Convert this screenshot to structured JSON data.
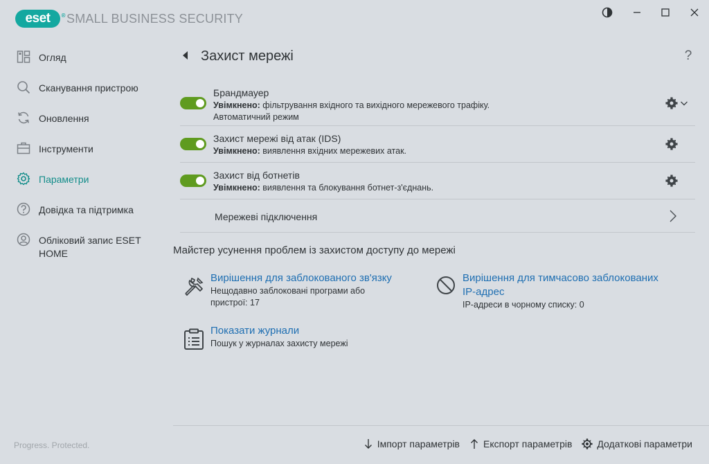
{
  "app": {
    "logo_text": "eset",
    "logo_mark": "®",
    "product_name": "SMALL BUSINESS SECURITY"
  },
  "window_controls": [
    {
      "name": "theme-toggle-icon"
    },
    {
      "name": "minimize-icon"
    },
    {
      "name": "maximize-icon"
    },
    {
      "name": "close-icon"
    }
  ],
  "sidebar": {
    "items": [
      {
        "label": "Огляд",
        "icon": "overview-icon"
      },
      {
        "label": "Сканування пристрою",
        "icon": "search-icon"
      },
      {
        "label": "Оновлення",
        "icon": "refresh-icon"
      },
      {
        "label": "Інструменти",
        "icon": "briefcase-icon"
      },
      {
        "label": "Параметри",
        "icon": "gear-icon",
        "active": true
      },
      {
        "label": "Довідка та підтримка",
        "icon": "help-icon"
      },
      {
        "label": "Обліковий запис ESET HOME",
        "icon": "account-icon"
      }
    ],
    "footer": "Progress. Protected."
  },
  "page": {
    "title": "Захист мережі",
    "help": "?"
  },
  "settings": [
    {
      "title": "Брандмауер",
      "status": "Увімкнено:",
      "desc": " фільтрування вхідного та вихідного мережевого трафіку.",
      "sub": "Автоматичний режим",
      "enabled": true
    },
    {
      "title": "Захист мережі від атак (IDS)",
      "status": "Увімкнено:",
      "desc": " виявлення вхідних мережевих атак.",
      "enabled": true
    },
    {
      "title": "Захист від ботнетів",
      "status": "Увімкнено:",
      "desc": " виявлення та блокування ботнет-з'єднань.",
      "enabled": true
    },
    {
      "title": "Мережеві підключення"
    }
  ],
  "wizard": {
    "title": "Майстер усунення проблем із захистом доступу до мережі",
    "items": [
      {
        "link": "Вирішення для заблокованого зв'язку",
        "desc_line1": "Нещодавно заблоковані програми або",
        "desc_line2": "пристрої: 17",
        "icon": "tools-icon"
      },
      {
        "link_line1": "Вирішення для тимчасово заблокованих",
        "link_line2": "IP-адрес",
        "desc": "IP-адреси в чорному списку: 0",
        "icon": "blocked-icon"
      },
      {
        "link": "Показати журнали",
        "desc": "Пошук у журналах захисту мережі",
        "icon": "clipboard-icon"
      }
    ]
  },
  "footer": {
    "import": "Імпорт параметрів",
    "export": "Експорт параметрів",
    "advanced": "Додаткові параметри"
  },
  "colors": {
    "accent": "#138d8a",
    "toggle_on": "#5f9b1f",
    "link": "#1f6fb2",
    "background": "#d9dde2"
  }
}
